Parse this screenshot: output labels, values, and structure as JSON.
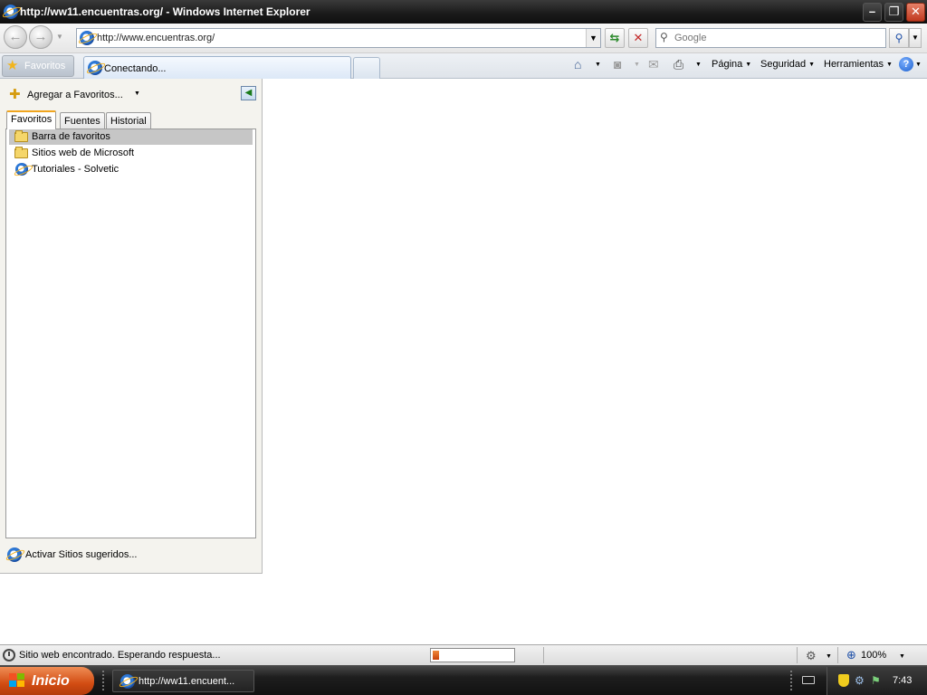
{
  "window": {
    "title": "http://ww11.encuentras.org/ - Windows Internet Explorer",
    "minimize_glyph": "–",
    "maximize_glyph": "❐",
    "close_glyph": "✕"
  },
  "navigation": {
    "back_glyph": "←",
    "forward_glyph": "→",
    "address": "http://www.encuentras.org/",
    "search_placeholder": "Google"
  },
  "tabs": {
    "favorites_button": "Favoritos",
    "active_tab": "Conectando..."
  },
  "commands": {
    "pagina": "Página",
    "seguridad": "Seguridad",
    "herramientas": "Herramientas",
    "help_glyph": "?"
  },
  "favorites_pane": {
    "add_to_favorites": "Agregar a Favoritos...",
    "tabs": [
      "Favoritos",
      "Fuentes",
      "Historial"
    ],
    "items": [
      {
        "label": "Barra de favoritos",
        "type": "folder",
        "selected": true
      },
      {
        "label": "Sitios web de Microsoft",
        "type": "folder",
        "selected": false
      },
      {
        "label": "Tutoriales - Solvetic",
        "type": "page",
        "selected": false
      }
    ],
    "suggested_sites": "Activar Sitios sugeridos..."
  },
  "statusbar": {
    "status_text": "Sitio web encontrado. Esperando respuesta...",
    "progress_percent": 8,
    "zoom": "100%"
  },
  "taskbar": {
    "start_label": "Inicio",
    "task_ie_label": "http://ww11.encuent...",
    "clock": "7:43"
  },
  "colors": {
    "start_button": "#d24c12",
    "progress_fill": "#e06a20",
    "selection": "#c6c6c6"
  },
  "icons": [
    "ie-logo-icon",
    "star-icon",
    "home-icon",
    "feeds-icon",
    "mail-icon",
    "print-icon",
    "help-icon",
    "folder-icon",
    "refresh-icon",
    "stop-icon",
    "search-icon",
    "zoom-icon",
    "shield-icon",
    "network-icon",
    "keyboard-icon",
    "windows-logo-icon"
  ]
}
